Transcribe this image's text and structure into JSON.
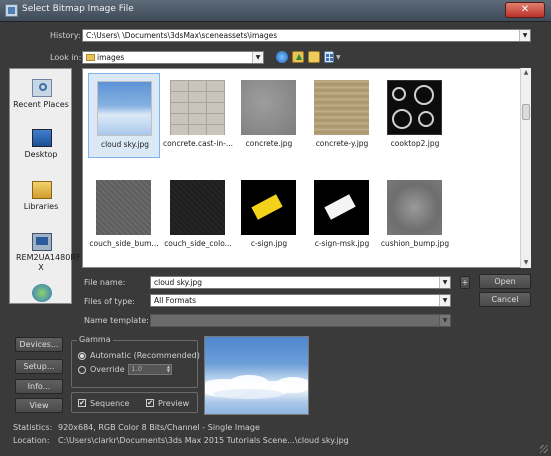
{
  "window": {
    "title": "Select Bitmap Image File",
    "close_glyph": "✕"
  },
  "history": {
    "label": "History:",
    "value": "C:\\Users\\          \\Documents\\3dsMax\\sceneassets\\images"
  },
  "lookin": {
    "label": "Look in:",
    "value": "images"
  },
  "toolbar_icons": [
    "back-icon",
    "up-folder-icon",
    "new-folder-icon",
    "view-menu-icon"
  ],
  "places": [
    {
      "label": "Recent Places"
    },
    {
      "label": "Desktop"
    },
    {
      "label": "Libraries"
    },
    {
      "label": "REM2UA1480RF X"
    },
    {
      "label": ""
    }
  ],
  "files": [
    {
      "name": "cloud sky.jpg"
    },
    {
      "name": "concrete.cast-in-..."
    },
    {
      "name": "concrete.jpg"
    },
    {
      "name": "concrete-y.jpg"
    },
    {
      "name": "cooktop2.jpg"
    },
    {
      "name": "couch_side_bum..."
    },
    {
      "name": "couch_side_colo..."
    },
    {
      "name": "c-sign.jpg"
    },
    {
      "name": "c-sign-msk.jpg"
    },
    {
      "name": "cushion_bump.jpg"
    }
  ],
  "form": {
    "filename_label": "File name:",
    "filename_value": "cloud sky.jpg",
    "filetype_label": "Files of type:",
    "filetype_value": "All Formats",
    "template_label": "Name template:",
    "template_value": "",
    "plus_label": "+",
    "open_label": "Open",
    "cancel_label": "Cancel"
  },
  "side_buttons": {
    "devices": "Devices...",
    "setup": "Setup...",
    "info": "Info...",
    "view": "View"
  },
  "gamma": {
    "title": "Gamma",
    "automatic": "Automatic (Recommended)",
    "override": "Override",
    "override_value": "1.0",
    "selected": "automatic"
  },
  "options": {
    "sequence": "Sequence",
    "preview": "Preview",
    "sequence_checked": true,
    "preview_checked": true,
    "check_glyph": "✔"
  },
  "statistics": {
    "label": "Statistics:",
    "value": "920x684, RGB Color 8 Bits/Channel - Single Image"
  },
  "location": {
    "label": "Location:",
    "value": "C:\\Users\\clarkr\\Documents\\3ds Max 2015 Tutorials Scene...\\cloud sky.jpg"
  }
}
